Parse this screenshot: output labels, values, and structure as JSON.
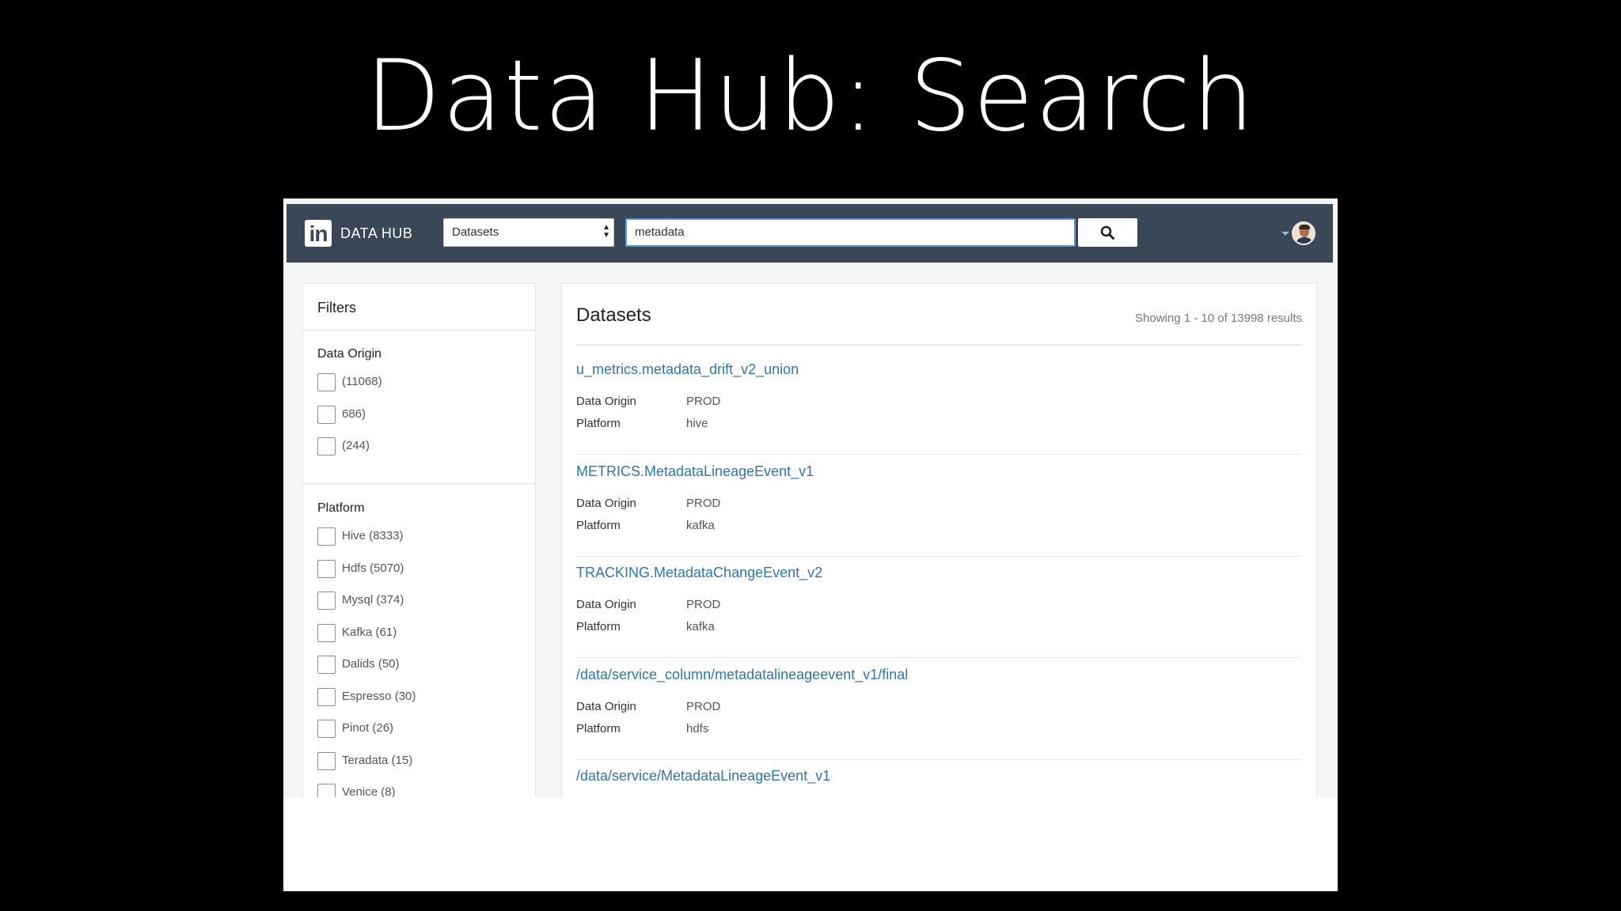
{
  "slide": {
    "title": "Data Hub: Search"
  },
  "nav": {
    "brand_logo": "in",
    "brand": "DATA HUB",
    "entity_select": "Datasets",
    "search_value": "metadata"
  },
  "filters": {
    "title": "Filters",
    "data_origin": {
      "title": "Data Origin",
      "items": [
        {
          "label": "(11068)"
        },
        {
          "label": "686)"
        },
        {
          "label": "(244)"
        }
      ]
    },
    "platform": {
      "title": "Platform",
      "items": [
        {
          "label": "Hive (8333)"
        },
        {
          "label": "Hdfs (5070)"
        },
        {
          "label": "Mysql (374)"
        },
        {
          "label": "Kafka (61)"
        },
        {
          "label": "Dalids (50)"
        },
        {
          "label": "Espresso (30)"
        },
        {
          "label": "Pinot (26)"
        },
        {
          "label": "Teradata (15)"
        },
        {
          "label": "Venice (8)"
        }
      ]
    }
  },
  "results": {
    "title": "Datasets",
    "count": "Showing 1 - 10 of 13998 results",
    "items": [
      {
        "title": "u_metrics.metadata_drift_v2_union",
        "origin_label": "Data Origin",
        "origin": "PROD",
        "platform_label": "Platform",
        "platform": "hive"
      },
      {
        "title": "METRICS.MetadataLineageEvent_v1",
        "origin_label": "Data Origin",
        "origin": "PROD",
        "platform_label": "Platform",
        "platform": "kafka"
      },
      {
        "title": "TRACKING.MetadataChangeEvent_v2",
        "origin_label": "Data Origin",
        "origin": "PROD",
        "platform_label": "Platform",
        "platform": "kafka"
      },
      {
        "title": "/data/service_column/metadatalineageevent_v1/final",
        "origin_label": "Data Origin",
        "origin": "PROD",
        "platform_label": "Platform",
        "platform": "hdfs"
      },
      {
        "title": "/data/service/MetadataLineageEvent_v1"
      }
    ]
  }
}
